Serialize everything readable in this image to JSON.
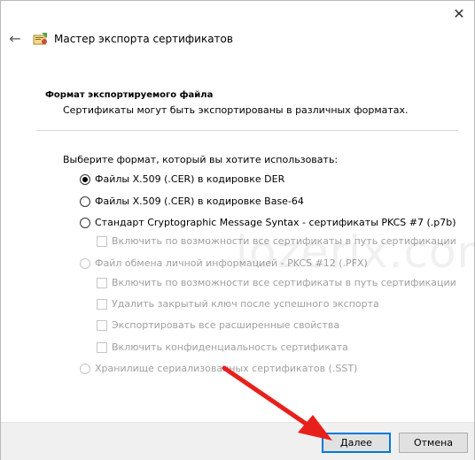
{
  "window": {
    "title": "Мастер экспорта сертификатов",
    "close_glyph": "✕",
    "back_glyph": "←"
  },
  "section": {
    "title": "Формат экспортируемого файла",
    "subtitle": "Сертификаты могут быть экспортированы в различных форматах."
  },
  "prompt": "Выберите формат, который вы хотите использовать:",
  "options": [
    {
      "label": "Файлы X.509 (.CER) в кодировке DER",
      "type": "radio",
      "checked": true,
      "enabled": true
    },
    {
      "label": "Файлы X.509 (.CER) в кодировке Base-64",
      "type": "radio",
      "checked": false,
      "enabled": true
    },
    {
      "label": "Стандарт Cryptographic Message Syntax - сертификаты PKCS #7 (.p7b)",
      "type": "radio",
      "checked": false,
      "enabled": true
    },
    {
      "label": "Включить по возможности все сертификаты в путь сертификации",
      "type": "checkbox",
      "checked": false,
      "enabled": false
    },
    {
      "label": "Файл обмена личной информацией - PKCS #12 (.PFX)",
      "type": "radio",
      "checked": false,
      "enabled": false
    },
    {
      "label": "Включить по возможности все сертификаты в путь сертификации",
      "type": "checkbox",
      "checked": false,
      "enabled": false
    },
    {
      "label": "Удалить закрытый ключ после успешного экспорта",
      "type": "checkbox",
      "checked": false,
      "enabled": false
    },
    {
      "label": "Экспортировать все расширенные свойства",
      "type": "checkbox",
      "checked": false,
      "enabled": false
    },
    {
      "label": "Включить конфиденциальность сертификата",
      "type": "checkbox",
      "checked": false,
      "enabled": false
    },
    {
      "label": "Хранилище сериализованных сертификатов (.SST)",
      "type": "radio",
      "checked": false,
      "enabled": false
    }
  ],
  "watermark": "lozerix.com",
  "footer": {
    "next_label": "Далее",
    "cancel_label": "Отмена"
  },
  "colors": {
    "accent": "#0078d7",
    "arrow": "#e8201c",
    "disabled_text": "#a0a0a0"
  },
  "icons": {
    "back": "back-arrow-icon",
    "app": "certificate-wizard-icon",
    "close": "close-icon"
  }
}
